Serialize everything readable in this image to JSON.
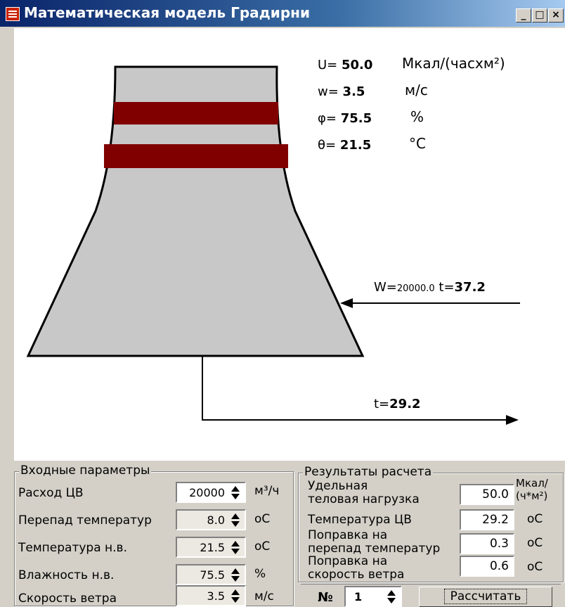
{
  "window": {
    "title": "Математическая модель Градирни",
    "minimize": "_",
    "maximize": "□",
    "close": "×"
  },
  "diagram": {
    "U": {
      "label": "U=",
      "value": "50.0",
      "unit": "Мкал/(часхм²)"
    },
    "w": {
      "label": "w=",
      "value": "3.5",
      "unit": "м/с"
    },
    "phi": {
      "label": "φ=",
      "value": "75.5",
      "unit": "%"
    },
    "theta": {
      "label": "θ=",
      "value": "21.5",
      "unit": "°С"
    },
    "inflow": {
      "W_label": "W=",
      "W_value": "20000.0",
      "t_label": "t=",
      "t_value": "37.2"
    },
    "outflow": {
      "t_label": "t=",
      "t_value": "29.2"
    }
  },
  "inputs": {
    "title": "Входные параметры",
    "rows": [
      {
        "label": "Расход ЦВ",
        "value": "20000",
        "unit": "м³/ч"
      },
      {
        "label": "Перепад температур",
        "value": "8.0",
        "unit": "оС"
      },
      {
        "label": "Температура н.в.",
        "value": "21.5",
        "unit": "оС"
      },
      {
        "label": "Влажность н.в.",
        "value": "75.5",
        "unit": "%"
      },
      {
        "label": "Скорость ветра",
        "value": "3.5",
        "unit": "м/с"
      }
    ]
  },
  "results": {
    "title": "Результаты расчета",
    "rows": [
      {
        "label1": "Удельная",
        "label2": "теловая нагрузка",
        "value": "50.0",
        "unit1": "Мкал/",
        "unit2": "(ч*м²)"
      },
      {
        "label1": "Температура ЦВ",
        "label2": "",
        "value": "29.2",
        "unit1": "оС",
        "unit2": ""
      },
      {
        "label1": "Поправка на",
        "label2": "перепад температур",
        "value": "0.3",
        "unit1": "оС",
        "unit2": ""
      },
      {
        "label1": "Поправка на",
        "label2": "скорость ветра",
        "value": "0.6",
        "unit1": "оС",
        "unit2": ""
      }
    ]
  },
  "footer": {
    "number_label": "№",
    "number_value": "1",
    "calc_label": "Рассчитать"
  },
  "colors": {
    "tower": "#c8c8c8",
    "band": "#800000",
    "titlebar": "#0a246a"
  }
}
